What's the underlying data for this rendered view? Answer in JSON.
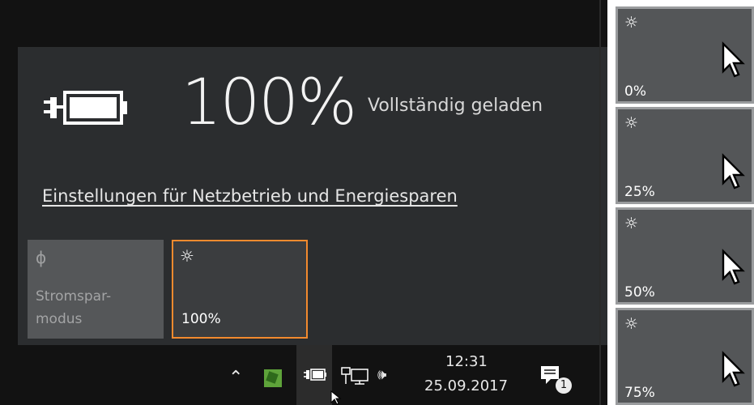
{
  "flyout": {
    "battery_percent": "100%",
    "battery_status": "Vollständig geladen",
    "settings_link": "Einstellungen für Netzbetrieb und Energiesparen",
    "tiles": {
      "saver": {
        "icon": "leaf-icon",
        "label": "Stromspar-\nmodus",
        "active": false
      },
      "brightness": {
        "icon": "sun-icon",
        "label": "100%",
        "active": true
      }
    }
  },
  "taskbar": {
    "time": "12:31",
    "date": "25.09.2017",
    "notification_count": "1",
    "icons": [
      "chevron-up-icon",
      "app-icon",
      "power-plug-battery-icon",
      "network-icon",
      "volume-icon",
      "action-center-icon"
    ]
  },
  "brightness_states": [
    {
      "label": "0%",
      "level": 0
    },
    {
      "label": "25%",
      "level": 25
    },
    {
      "label": "50%",
      "level": 50
    },
    {
      "label": "75%",
      "level": 75
    }
  ],
  "colors": {
    "flyout_bg": "#2b2d2f",
    "tile_active_border": "#f28a2e",
    "taskbar_bg": "#121212"
  }
}
